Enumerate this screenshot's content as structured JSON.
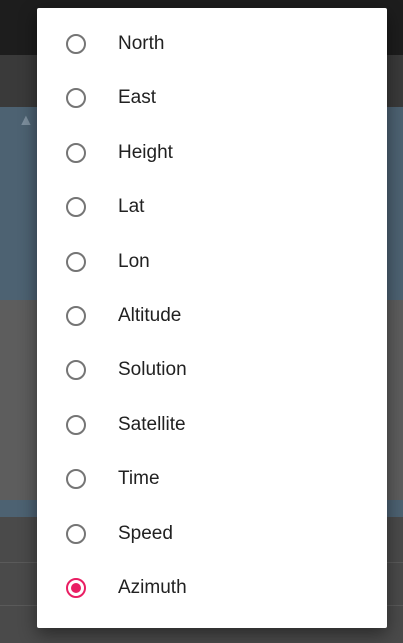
{
  "dialog": {
    "options": [
      {
        "label": "North",
        "selected": false
      },
      {
        "label": "East",
        "selected": false
      },
      {
        "label": "Height",
        "selected": false
      },
      {
        "label": "Lat",
        "selected": false
      },
      {
        "label": "Lon",
        "selected": false
      },
      {
        "label": "Altitude",
        "selected": false
      },
      {
        "label": "Solution",
        "selected": false
      },
      {
        "label": "Satellite",
        "selected": false
      },
      {
        "label": "Time",
        "selected": false
      },
      {
        "label": "Speed",
        "selected": false
      },
      {
        "label": "Azimuth",
        "selected": true
      }
    ]
  },
  "colors": {
    "accent": "#e91e63",
    "radio_unchecked": "#757575"
  }
}
